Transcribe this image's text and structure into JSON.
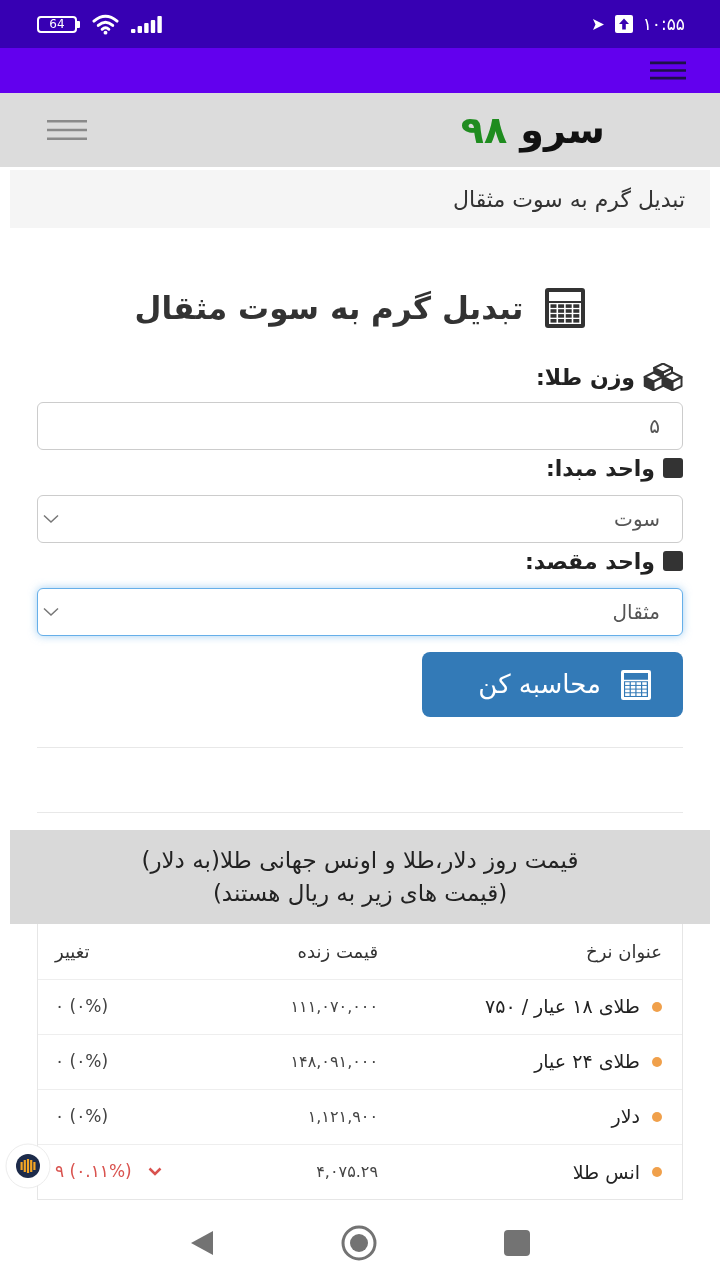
{
  "status_bar": {
    "battery": "64",
    "time": "۱۰:۵۵"
  },
  "header": {
    "logo": {
      "name": "سرو",
      "number": "۹۸"
    }
  },
  "breadcrumb": {
    "label": "تبدیل گرم به سوت مثقال"
  },
  "converter": {
    "title": "تبدیل گرم به سوت مثقال",
    "fields": [
      {
        "kind": "input",
        "label": "وزن طلا:",
        "value": "۵",
        "focused": false
      },
      {
        "kind": "select",
        "label": "واحد مبدا:",
        "value": "سوت",
        "focused": false
      },
      {
        "kind": "select",
        "label": "واحد مقصد:",
        "value": "مثقال",
        "focused": true
      }
    ],
    "button": "محاسبه کن"
  },
  "prices": {
    "title": "قیمت روز دلار،طلا و اونس جهانی طلا(به دلار)",
    "note": "(قیمت های زیر به ریال هستند)",
    "columns": [
      "عنوان نرخ",
      "قیمت زنده",
      "تغییر"
    ],
    "rows": [
      {
        "name": "طلای ۱۸ عیار / ۷۵۰",
        "price": "۱۱۱,۰۷۰,۰۰۰",
        "change": "۰ (۰%)",
        "falling": false
      },
      {
        "name": "طلای ۲۴ عیار",
        "price": "۱۴۸,۰۹۱,۰۰۰",
        "change": "۰ (۰%)",
        "falling": false
      },
      {
        "name": "دلار",
        "price": "۱,۱۲۱,۹۰۰",
        "change": "۰ (۰%)",
        "falling": false
      },
      {
        "name": "انس طلا",
        "price": "۴,۰۷۵.۲۹",
        "change": "۹ (۰.۱۱%)",
        "falling": true
      }
    ]
  }
}
